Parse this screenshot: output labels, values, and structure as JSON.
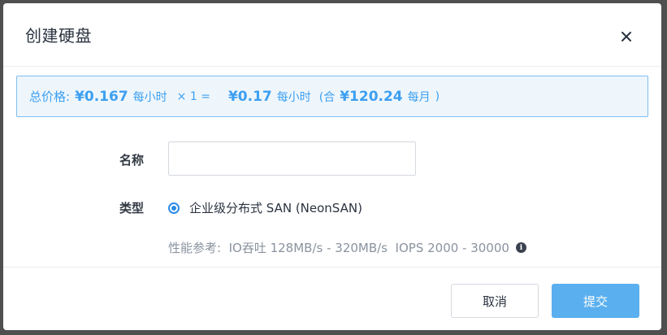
{
  "dialog": {
    "title": "创建硬盘",
    "close_icon": "close-icon"
  },
  "price": {
    "label": "总价格:",
    "unit_price": "¥0.167",
    "unit_price_period": "每小时",
    "multiplier": "× 1 =",
    "total_price": "¥0.17",
    "total_price_period": "每小时",
    "open_paren": "(合",
    "monthly_price": "¥120.24",
    "monthly_period": "每月",
    "close_paren": ")",
    "accent_color": "#3d9ff0"
  },
  "form": {
    "name_label": "名称",
    "name_value": "",
    "name_placeholder": "",
    "type_label": "类型",
    "type_option": "企业级分布式 SAN (NeonSAN)",
    "type_selected": true,
    "perf_text": "性能参考:  IO吞吐 128MB/s - 320MB/s  IOPS 2000 - 30000",
    "perf_icon": "info-icon"
  },
  "footer": {
    "cancel_label": "取消",
    "submit_label": "提交",
    "submit_color": "#5aafee"
  }
}
